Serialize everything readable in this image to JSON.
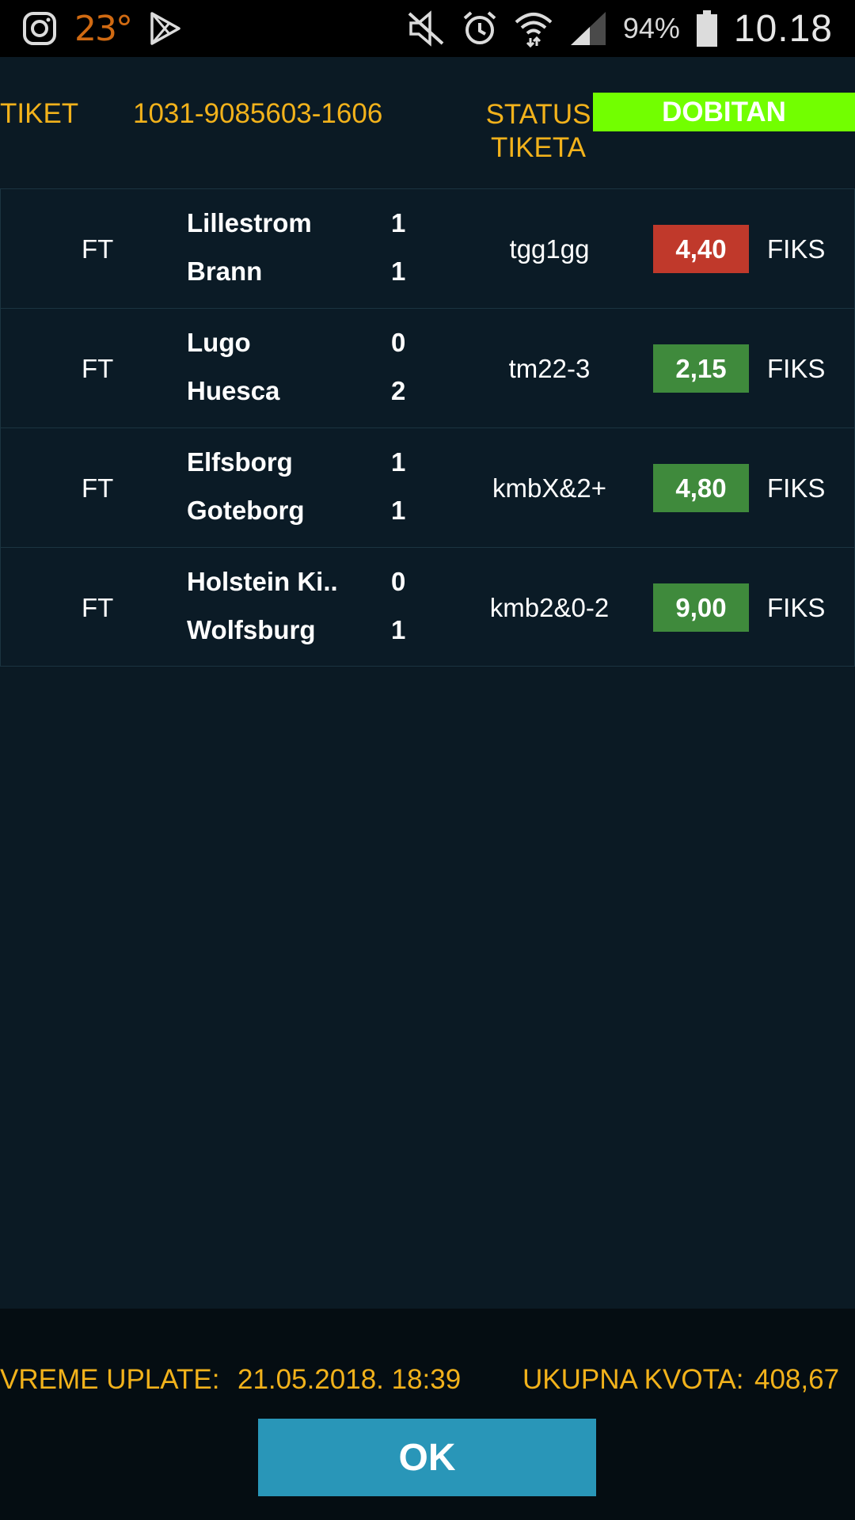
{
  "status_bar": {
    "temperature": "23°",
    "battery_percent": "94%",
    "time": "10.18",
    "icons": [
      "instagram-icon",
      "play-store-icon",
      "mute-icon",
      "alarm-icon",
      "wifi-icon",
      "signal-icon",
      "battery-icon"
    ]
  },
  "ticket": {
    "label": "TIKET",
    "number": "1031-9085603-1606",
    "status_label": "STATUS TIKETA",
    "status_value": "DOBITAN",
    "status_color": "#72ff00"
  },
  "matches": [
    {
      "period": "FT",
      "home": "Lillestrom",
      "away": "Brann",
      "home_score": "1",
      "away_score": "1",
      "tip": "tgg1gg",
      "odd": "4,40",
      "odd_color": "#c0392b",
      "type": "FIKS"
    },
    {
      "period": "FT",
      "home": "Lugo",
      "away": "Huesca",
      "home_score": "0",
      "away_score": "2",
      "tip": "tm22-3",
      "odd": "2,15",
      "odd_color": "#3f8a3c",
      "type": "FIKS"
    },
    {
      "period": "FT",
      "home": "Elfsborg",
      "away": "Goteborg",
      "home_score": "1",
      "away_score": "1",
      "tip": "kmbX&2+",
      "odd": "4,80",
      "odd_color": "#3f8a3c",
      "type": "FIKS"
    },
    {
      "period": "FT",
      "home": "Holstein Ki..",
      "away": "Wolfsburg",
      "home_score": "0",
      "away_score": "1",
      "tip": "kmb2&0-2",
      "odd": "9,00",
      "odd_color": "#3f8a3c",
      "type": "FIKS"
    }
  ],
  "footer": {
    "payment_time_label": "VREME UPLATE:",
    "payment_time": "21.05.2018. 18:39",
    "total_odds_label": "UKUPNA KVOTA:",
    "total_odds": "408,67",
    "ok_label": "OK"
  },
  "colors": {
    "accent": "#f2b21b",
    "background": "#0b1a24",
    "ok_button": "#2996b8"
  }
}
